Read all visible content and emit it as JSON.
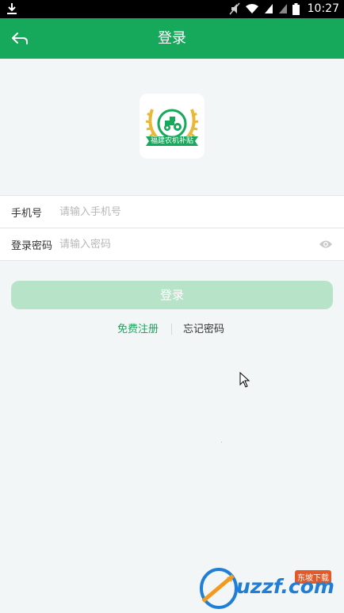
{
  "status_bar": {
    "time": "10:27",
    "icons": [
      "download-icon",
      "mute-icon",
      "wifi-icon",
      "signal-icon",
      "signal-icon",
      "battery-icon"
    ]
  },
  "app_bar": {
    "title": "登录",
    "back_icon": "back-arrow-icon"
  },
  "logo": {
    "text": "福建农机补贴",
    "colors": {
      "wreath": "#e8b83a",
      "ribbon": "#16a85b",
      "tractor": "#16a85b"
    }
  },
  "form": {
    "phone": {
      "label": "手机号",
      "placeholder": "请输入手机号",
      "value": ""
    },
    "password": {
      "label": "登录密码",
      "placeholder": "请输入密码",
      "value": "",
      "toggle_icon": "eye-icon"
    }
  },
  "login_button": {
    "label": "登录"
  },
  "links": {
    "register": "免费注册",
    "forgot": "忘记密码"
  },
  "watermark": {
    "text": "uzzf.com",
    "tag": "东坡下载"
  },
  "colors": {
    "primary": "#16a85b",
    "button_disabled": "#b7e4c9",
    "background": "#f2f6f7"
  }
}
